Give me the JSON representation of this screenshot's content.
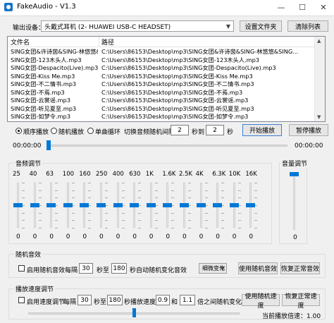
{
  "window": {
    "title": "FakeAudio - V1.3",
    "minimize_glyph": "—",
    "maximize_glyph": "☐",
    "close_glyph": "✕"
  },
  "output": {
    "label": "输出设备：",
    "device": "头戴式耳机 (2- HUAWEI USB-C HEADSET)",
    "set_folder_button": "设置文件夹",
    "clear_list_button": "清除列表"
  },
  "file_table": {
    "columns": [
      "文件名",
      "路径"
    ],
    "rows": [
      [
        "SING女团&许诗茵&SING-林悠悠&...",
        "C:\\Users\\86153\\Desktop\\mp3\\SING女团&许诗茵&SING-林悠悠&SING..."
      ],
      [
        "SING女团-123木头人.mp3",
        "C:\\Users\\86153\\Desktop\\mp3\\SING女团-123木头人.mp3"
      ],
      [
        "SING女团-Despacito(Live).mp3",
        "C:\\Users\\86153\\Desktop\\mp3\\SING女团-Despacito(Live).mp3"
      ],
      [
        "SING女团-Kiss Me.mp3",
        "C:\\Users\\86153\\Desktop\\mp3\\SING女团-Kiss Me.mp3"
      ],
      [
        "SING女团-不二情书.mp3",
        "C:\\Users\\86153\\Desktop\\mp3\\SING女团-不二情书.mp3"
      ],
      [
        "SING女团-不焉.mp3",
        "C:\\Users\\86153\\Desktop\\mp3\\SING女团-不焉.mp3"
      ],
      [
        "SING女团-云裳谣.mp3",
        "C:\\Users\\86153\\Desktop\\mp3\\SING女团-云裳谣.mp3"
      ],
      [
        "SING女团-听见夏至.mp3",
        "C:\\Users\\86153\\Desktop\\mp3\\SING女团-听见夏至.mp3"
      ],
      [
        "SING女团-如梦令.mp3",
        "C:\\Users\\86153\\Desktop\\mp3\\SING女团-如梦令.mp3"
      ]
    ]
  },
  "playback": {
    "mode_sequential": "顺序播放",
    "mode_random": "随机播放",
    "mode_single_loop": "单曲循环",
    "selected_mode": "顺序播放",
    "switch_interval_label": "切换音频随机间隔",
    "interval_from": "2",
    "interval_to_label": "秒到",
    "interval_to": "2",
    "seconds_label": "秒",
    "start_button": "开始播放",
    "pause_button": "暂停播放",
    "time_current": "00:00:00",
    "time_total": "00:00:00",
    "progress_fraction": 0.0
  },
  "equalizer": {
    "title": "音频调节",
    "bands": [
      "25",
      "40",
      "63",
      "100",
      "160",
      "250",
      "400",
      "630",
      "1K",
      "1.6K",
      "2.5K",
      "4K",
      "6.3K",
      "10K",
      "16K"
    ],
    "values": [
      0,
      0,
      0,
      0,
      0,
      0,
      0,
      0,
      0,
      0,
      0,
      0,
      0,
      0,
      0
    ],
    "value_labels": [
      "0",
      "0",
      "0",
      "0",
      "0",
      "0",
      "0",
      "0",
      "0",
      "0",
      "0",
      "0",
      "0",
      "0",
      "0"
    ],
    "range": [
      -12,
      12
    ]
  },
  "volume": {
    "title": "音量调节",
    "value": "0",
    "level_fraction": 1.0
  },
  "random_effect": {
    "title": "随机音效",
    "enable_label": "启用随机音效",
    "enabled": false,
    "every_label": "每隔",
    "from": "30",
    "to_label": "秒至",
    "to": "180",
    "auto_label": "秒自动随机变化音效",
    "effect_select": "细微变化",
    "apply_button": "使用随机音效",
    "restore_button": "恢复正常音效"
  },
  "speed": {
    "title": "播放速度调节",
    "enable_label": "启用速度调节",
    "enabled": false,
    "every_label": "每隔",
    "from": "30",
    "to_label": "秒至",
    "to": "180",
    "speed_label": "秒播放速度在",
    "min": "0.9",
    "and_label": "和",
    "max": "1.1",
    "between_label": "倍之间随机变化",
    "apply_button": "使用随机速度",
    "restore_button": "恢复正常速度",
    "current_label": "当前播放倍速：1.00",
    "speed_fraction": 0.5
  },
  "colors": {
    "accent": "#0078d7",
    "background": "#f0f0f0"
  }
}
